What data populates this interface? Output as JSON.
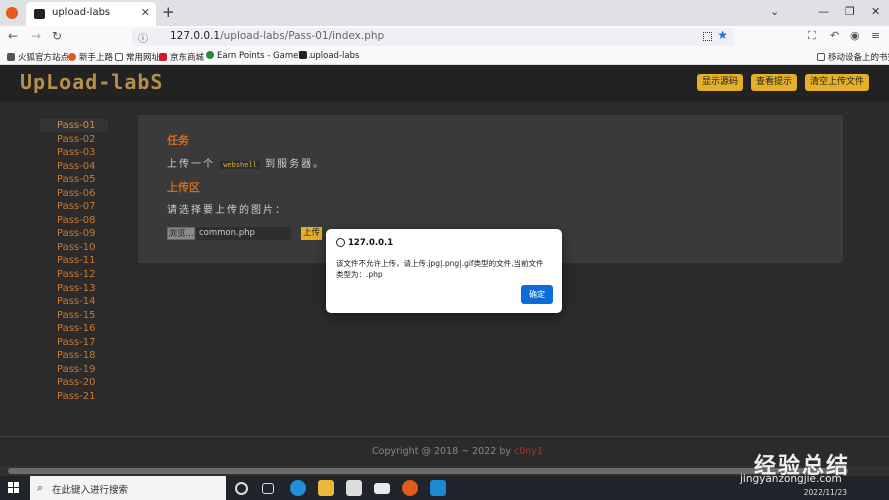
{
  "browser": {
    "tab_title": "upload-labs",
    "new_tab": "+",
    "tab_close": "✕",
    "url_host": "127.0.0.1",
    "url_path": "/upload-labs/Pass-01/index.php",
    "bookmarks": [
      "火狐官方站点",
      "新手上路",
      "常用网址",
      "京东商城",
      "Earn Points - GameT...",
      "upload-labs"
    ],
    "mobile_bookmarks": "移动设备上的书签"
  },
  "header": {
    "logo": "UpLoad-labS",
    "buttons": [
      "显示源码",
      "查看提示",
      "清空上传文件"
    ]
  },
  "sidebar": {
    "items": [
      "Pass-01",
      "Pass-02",
      "Pass-03",
      "Pass-04",
      "Pass-05",
      "Pass-06",
      "Pass-07",
      "Pass-08",
      "Pass-09",
      "Pass-10",
      "Pass-11",
      "Pass-12",
      "Pass-13",
      "Pass-14",
      "Pass-15",
      "Pass-16",
      "Pass-17",
      "Pass-18",
      "Pass-19",
      "Pass-20",
      "Pass-21"
    ],
    "active_index": 0
  },
  "main": {
    "task_heading": "任务",
    "task_prefix": "上传一个",
    "task_code": "webshell",
    "task_suffix": "到服务器。",
    "upload_heading": "上传区",
    "upload_prompt": "请选择要上传的图片：",
    "browse_label": "浏览...",
    "file_name": "common.php",
    "upload_button": "上传"
  },
  "footer": {
    "text": "Copyright @ 2018 ~ 2022 by",
    "author": "c0ny1"
  },
  "dialog": {
    "title": "127.0.0.1",
    "message": "该文件不允许上传，请上传.jpg|.png|.gif类型的文件,当前文件类型为：.php",
    "ok_label": "确定"
  },
  "taskbar": {
    "search_placeholder": "在此键入进行搜索",
    "date": "2022/11/23"
  },
  "watermark": {
    "line1": "经验总结",
    "line2": "jingyanzongjie.com"
  },
  "colors": {
    "accent_yellow": "#e4b02a",
    "heading_orange": "#d2691e",
    "dialog_button_blue": "#0a6dd8"
  }
}
